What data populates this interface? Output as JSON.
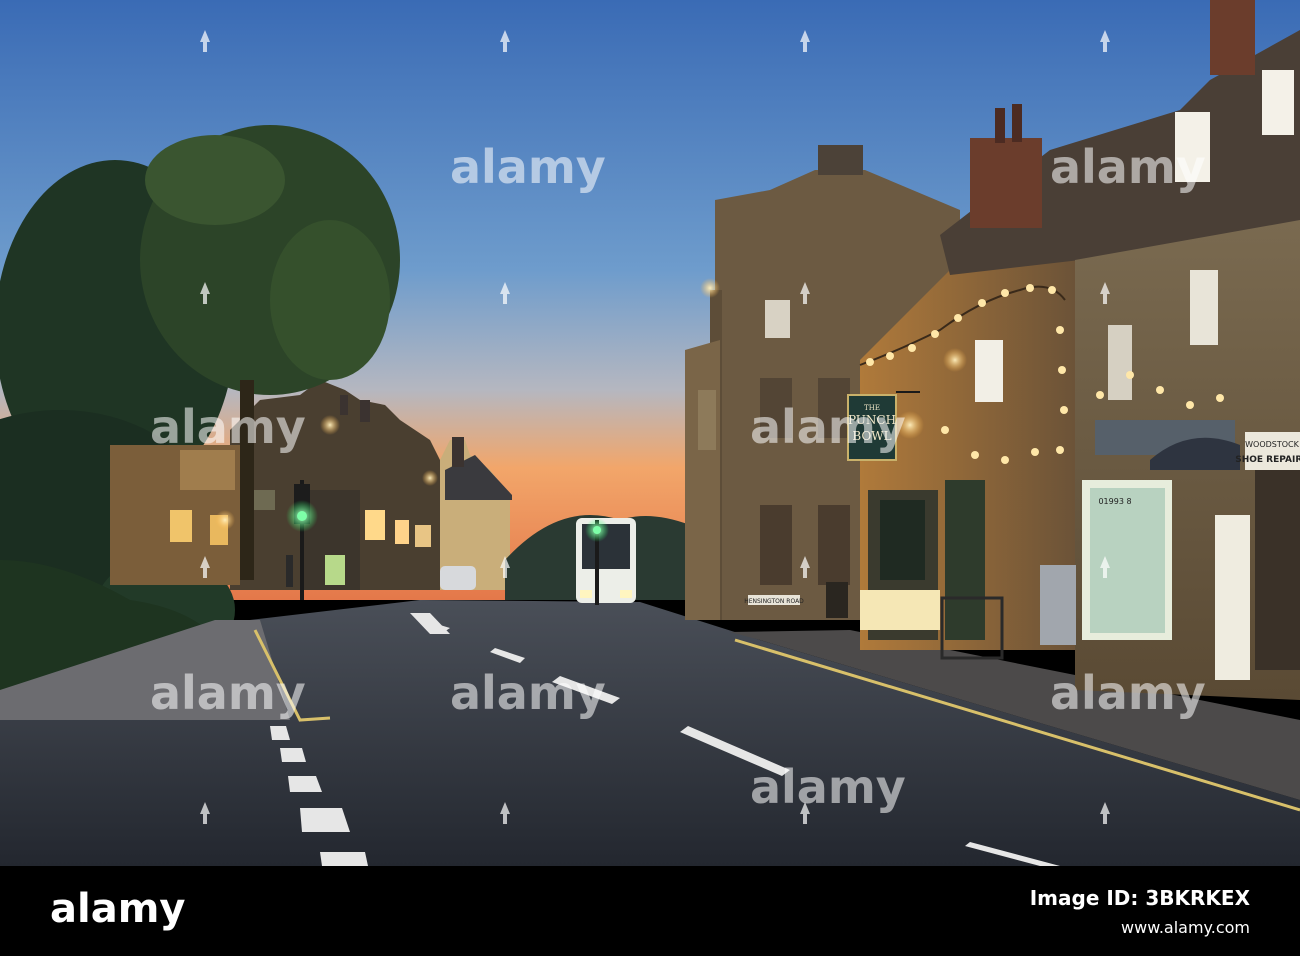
{
  "scene": {
    "description_free": true,
    "sign_pub": {
      "line1": "THE",
      "line2": "PUNCH",
      "line3": "BOWL"
    },
    "sign_road": "HENSINGTON ROAD",
    "sign_shoe": {
      "line1": "WOODSTOCK",
      "line2": "SHOE REPAIRS"
    },
    "sign_phone": "01993 8",
    "colors": {
      "sky_top": "#3d6fb8",
      "sky_mid": "#6f9bcc",
      "sky_glow": "#f4a46a",
      "road": "#2e343e",
      "lamp": "#ffd27a",
      "traffic_green": "#3cff7a",
      "stone": "#8a6d45"
    }
  },
  "watermark": {
    "text": "alamy",
    "icon": "alamy-logo-icon"
  },
  "footer": {
    "brand": "alamy",
    "image_id": "Image ID: 3BKRKEX",
    "url": "www.alamy.com"
  }
}
